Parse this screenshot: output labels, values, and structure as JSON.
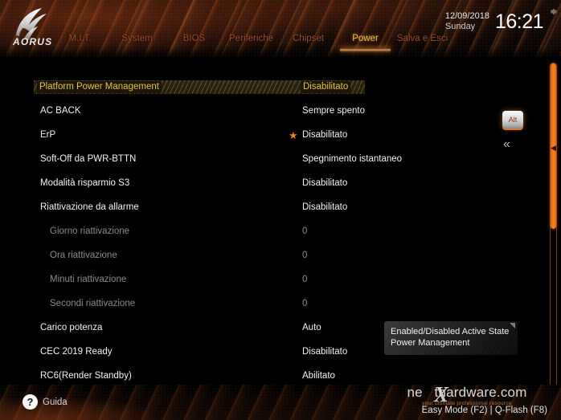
{
  "header": {
    "logo_text": "AORUS",
    "date": "12/09/2018",
    "day": "Sunday",
    "time": "16:21",
    "gear_icon": "gear-icon",
    "tabs": [
      {
        "label": "M.I.T.",
        "active": false
      },
      {
        "label": "System",
        "active": false
      },
      {
        "label": "BIOS",
        "active": false
      },
      {
        "label": "Periferiche",
        "active": false
      },
      {
        "label": "Chipset",
        "active": false
      },
      {
        "label": "Power",
        "active": true
      },
      {
        "label": "Salva e Esci",
        "active": false
      }
    ]
  },
  "section": {
    "title": "Platform Power Management",
    "value": "Disabilitato"
  },
  "settings": [
    {
      "label": "AC BACK",
      "value": "Sempre spento",
      "sub": false,
      "star": false
    },
    {
      "label": "ErP",
      "value": "Disabilitato",
      "sub": false,
      "star": true
    },
    {
      "label": "Soft-Off da PWR-BTTN",
      "value": "Spegnimento istantaneo",
      "sub": false,
      "star": false
    },
    {
      "label": "Modalità risparmio S3",
      "value": "Disabilitato",
      "sub": false,
      "star": false
    },
    {
      "label": "Riattivazione da allarme",
      "value": "Disabilitato",
      "sub": false,
      "star": false
    },
    {
      "label": "Giorno riattivazione",
      "value": "0",
      "sub": true,
      "star": false
    },
    {
      "label": "Ora riattivazione",
      "value": "0",
      "sub": true,
      "star": false
    },
    {
      "label": "Minuti riattivazione",
      "value": "0",
      "sub": true,
      "star": false
    },
    {
      "label": "Secondi riattivazione",
      "value": "0",
      "sub": true,
      "star": false
    },
    {
      "label": "Carico potenza",
      "value": "Auto",
      "sub": false,
      "star": false
    },
    {
      "label": "CEC 2019 Ready",
      "value": "Disabilitato",
      "sub": false,
      "star": false
    },
    {
      "label": "RC6(Render Standby)",
      "value": "Abilitato",
      "sub": false,
      "star": false
    }
  ],
  "side_controls": {
    "alt_key_label": "Alt",
    "collapse_icon": "«"
  },
  "tooltip": {
    "text": "Enabled/Disabled Active State Power Management"
  },
  "footer": {
    "help_icon": "?",
    "help_label": "Guida",
    "keys": "Easy Mode (F2)  |  Q-Flash (F8)",
    "watermark_main": "ne   thardware.com",
    "watermark_x": "X",
    "watermark_sub": "your ultimate professional resource"
  },
  "colors": {
    "accent_orange": "#ef7b17",
    "active_tab_text": "#f0c24a",
    "inactive_tab_text": "#9e4a28",
    "section_title": "#e6c23c",
    "value_text": "#f2f2f2",
    "disabled_text": "#8a8a8a",
    "background": "#000000"
  }
}
